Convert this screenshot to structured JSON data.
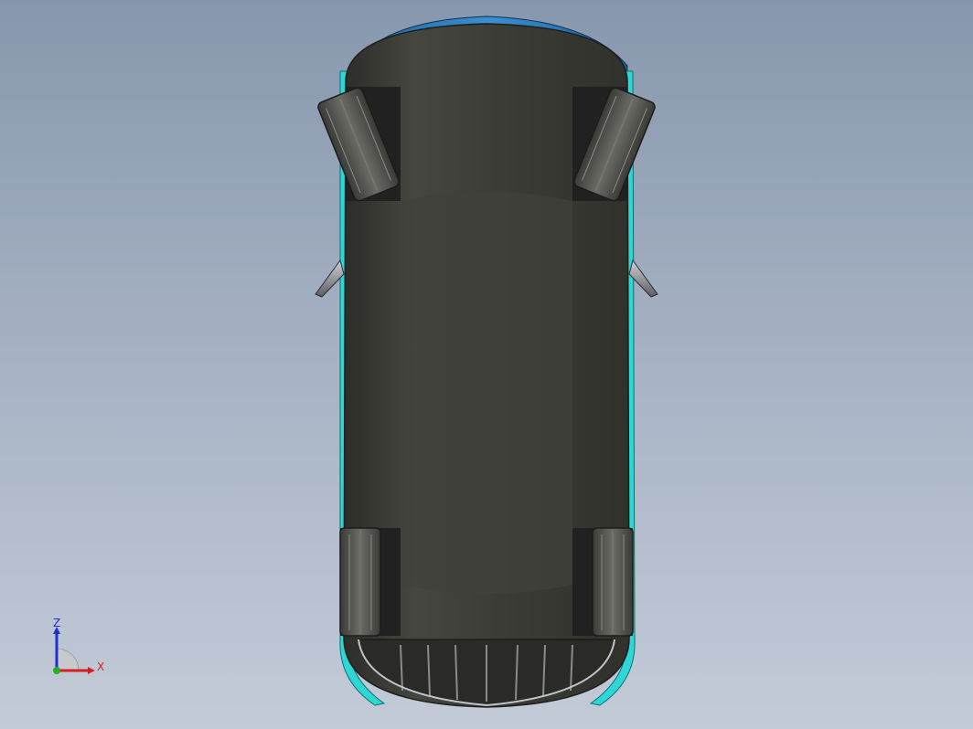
{
  "viewport": {
    "background_top": "#8797ad",
    "background_bottom": "#c3cbd8",
    "model": {
      "body_color": "#3a3b36",
      "accent_color": "#2fd6d6",
      "tire_color": "#4a4b46"
    }
  },
  "triad": {
    "z_label": "Z",
    "x_label": "X",
    "z_color": "#2030d0",
    "x_color": "#d02020",
    "y_color": "#20b020"
  }
}
